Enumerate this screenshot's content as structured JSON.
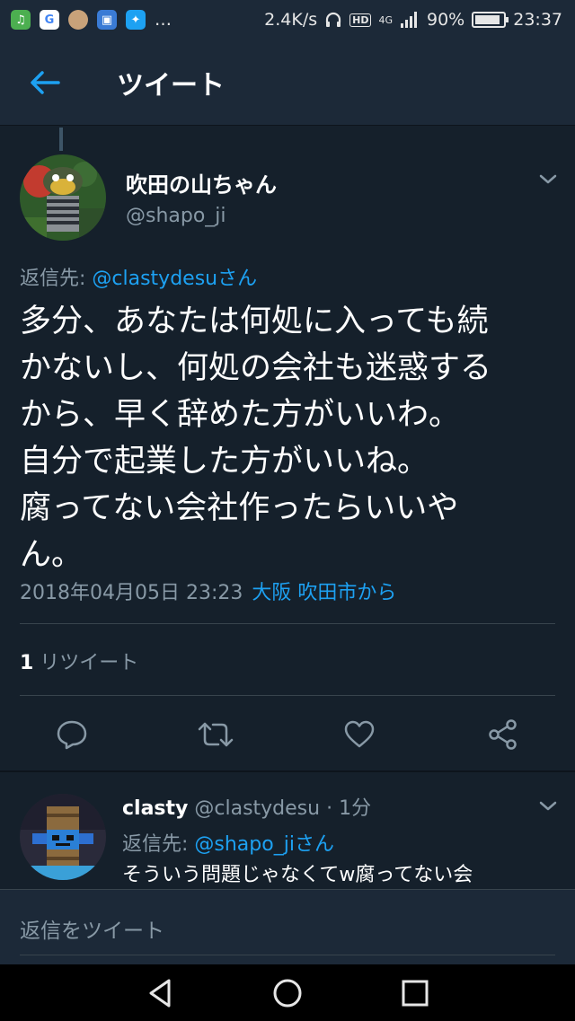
{
  "status_bar": {
    "speed": "2.4K/s",
    "hd": "HD",
    "network": "4G",
    "battery": "90%",
    "battery_level": 0.9,
    "time": "23:37",
    "more": "…"
  },
  "header": {
    "title": "ツイート"
  },
  "tweet": {
    "user_name": "吹田の山ちゃん",
    "handle": "@shapo_ji",
    "reply_prefix": "返信先: ",
    "reply_mention": "@clastydesuさん",
    "text": "多分、あなたは何処に入っても続\nかないし、何処の会社も迷惑する\nから、早く辞めた方がいいわ。\n自分で起業した方がいいね。\n腐ってない会社作ったらいいや\nん。",
    "datetime": "2018年04月05日 23:23",
    "location": "大阪 吹田市から",
    "retweet_count": "1",
    "retweet_label": " リツイート"
  },
  "reply": {
    "name": "clasty",
    "meta": " @clastydesu · 1分",
    "reply_prefix": "返信先: ",
    "reply_mention": "@shapo_jiさん",
    "text": "そういう問題じゃなくてw腐ってない会"
  },
  "compose": {
    "placeholder": "返信をツイート"
  },
  "colors": {
    "background": "#15202b",
    "bar": "#1c2938",
    "accent": "#1da1f2",
    "muted": "#8899a6"
  }
}
